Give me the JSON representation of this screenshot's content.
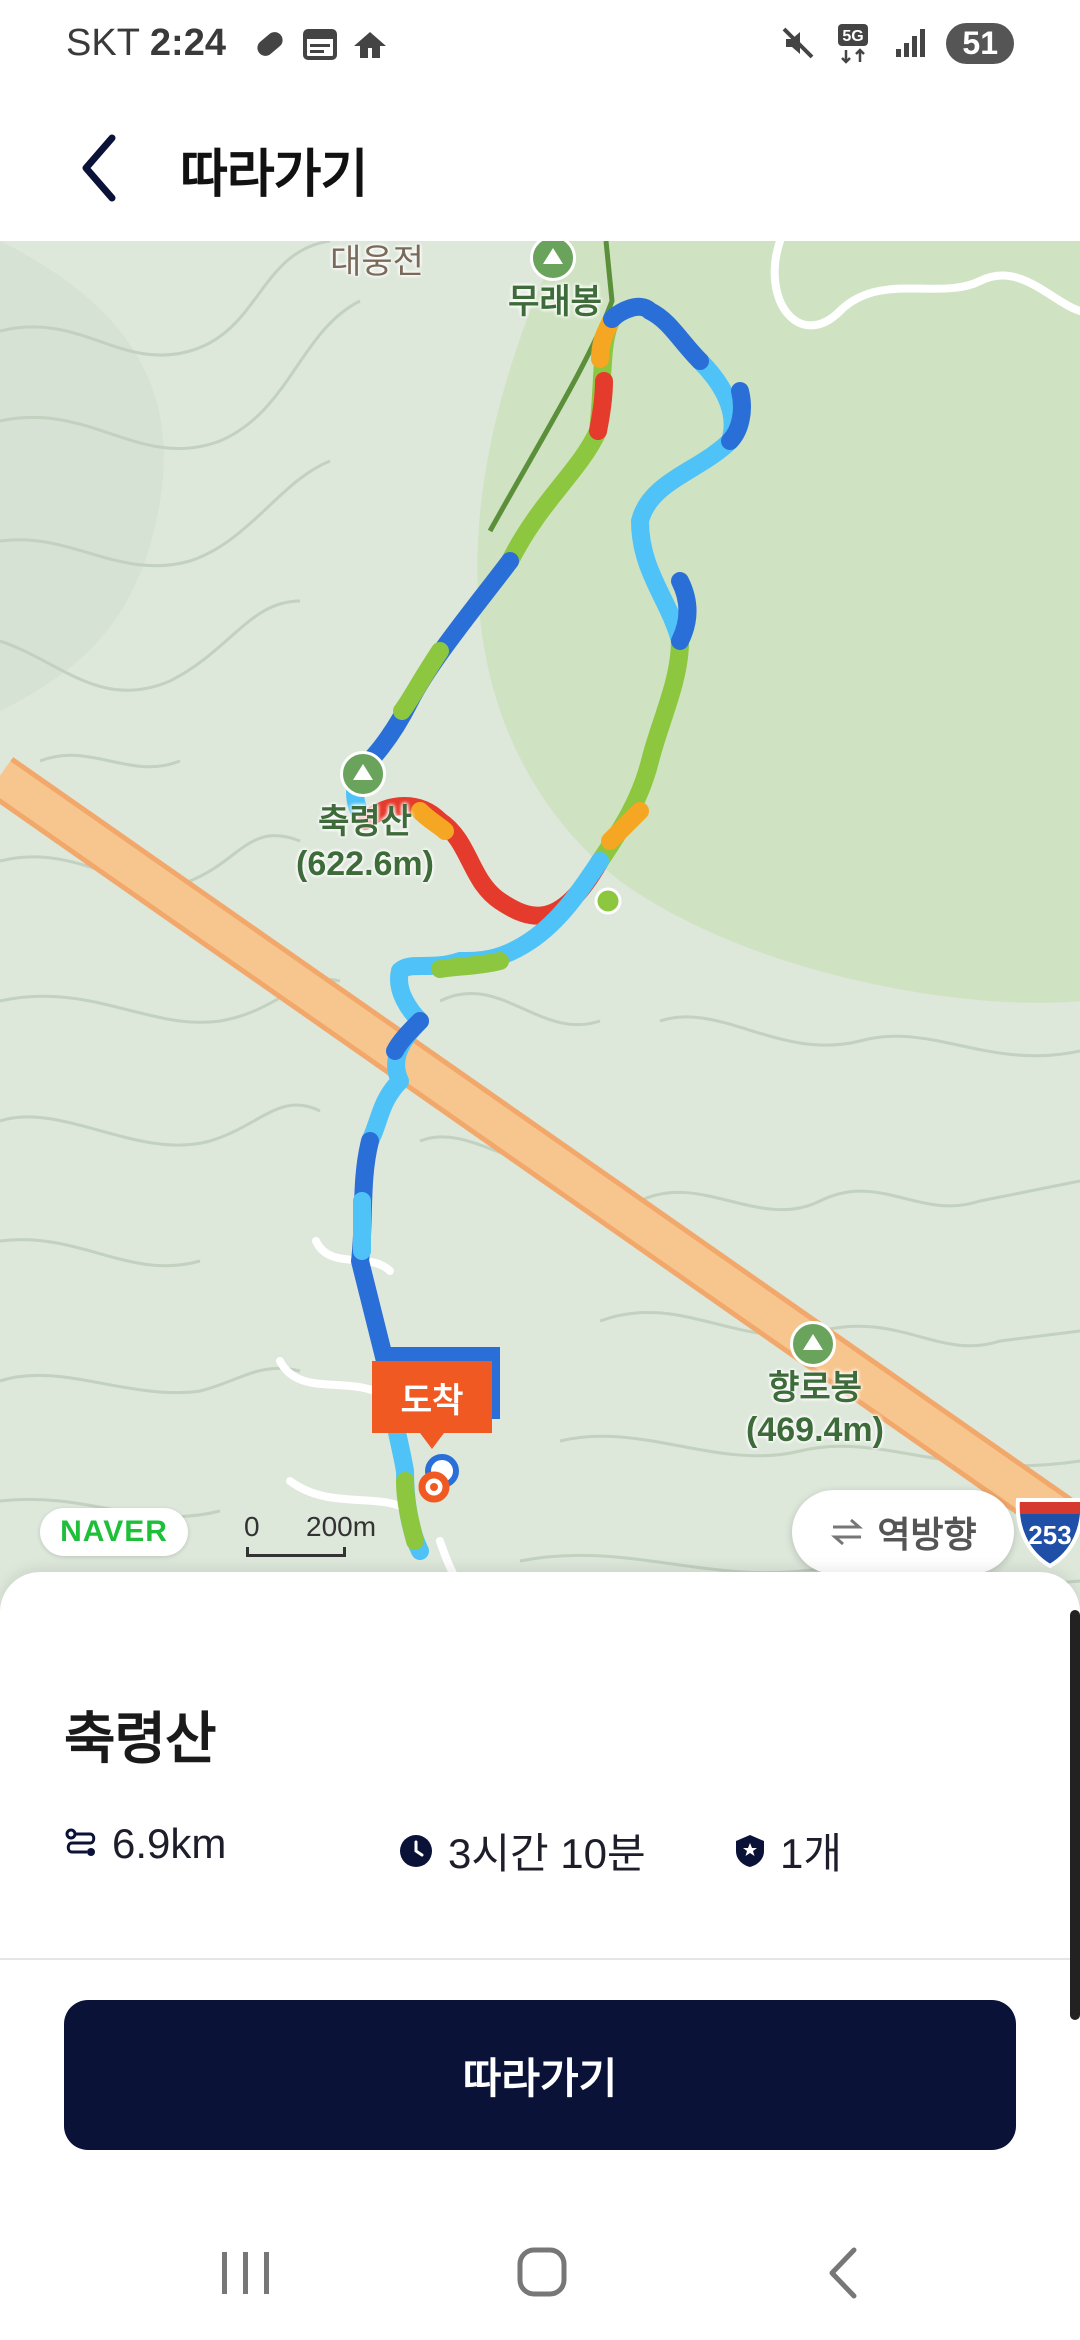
{
  "status_bar": {
    "carrier": "SKT",
    "time": "2:24",
    "network": "5G",
    "battery": "51"
  },
  "app_bar": {
    "title": "따라가기",
    "back_icon": "chevron-left-icon"
  },
  "map": {
    "labels": {
      "temple": "대웅전",
      "peak_murae": "무래봉",
      "peak_chukryeong_name": "축령산",
      "peak_chukryeong_elev": "(622.6m)",
      "peak_hyangro_name": "향로봉",
      "peak_hyangro_elev": "(469.4m)"
    },
    "arrival_label": "도착",
    "provider_logo": "NAVER",
    "scale": {
      "zero": "0",
      "distance": "200m"
    },
    "reverse_button": "역방향",
    "highway_number": "253"
  },
  "course": {
    "name": "축령산",
    "distance": "6.9km",
    "duration": "3시간 10분",
    "badge_count": "1개"
  },
  "actions": {
    "follow_label": "따라가기"
  },
  "colors": {
    "primary_button": "#0b1238",
    "arrival_flag": "#f05a22",
    "naver_green": "#1fbf3a",
    "track_red": "#e53b2c",
    "track_green": "#8dc63f",
    "track_blue": "#2a6fd8",
    "track_cyan": "#4fc3f7",
    "track_orange": "#f5a623"
  }
}
